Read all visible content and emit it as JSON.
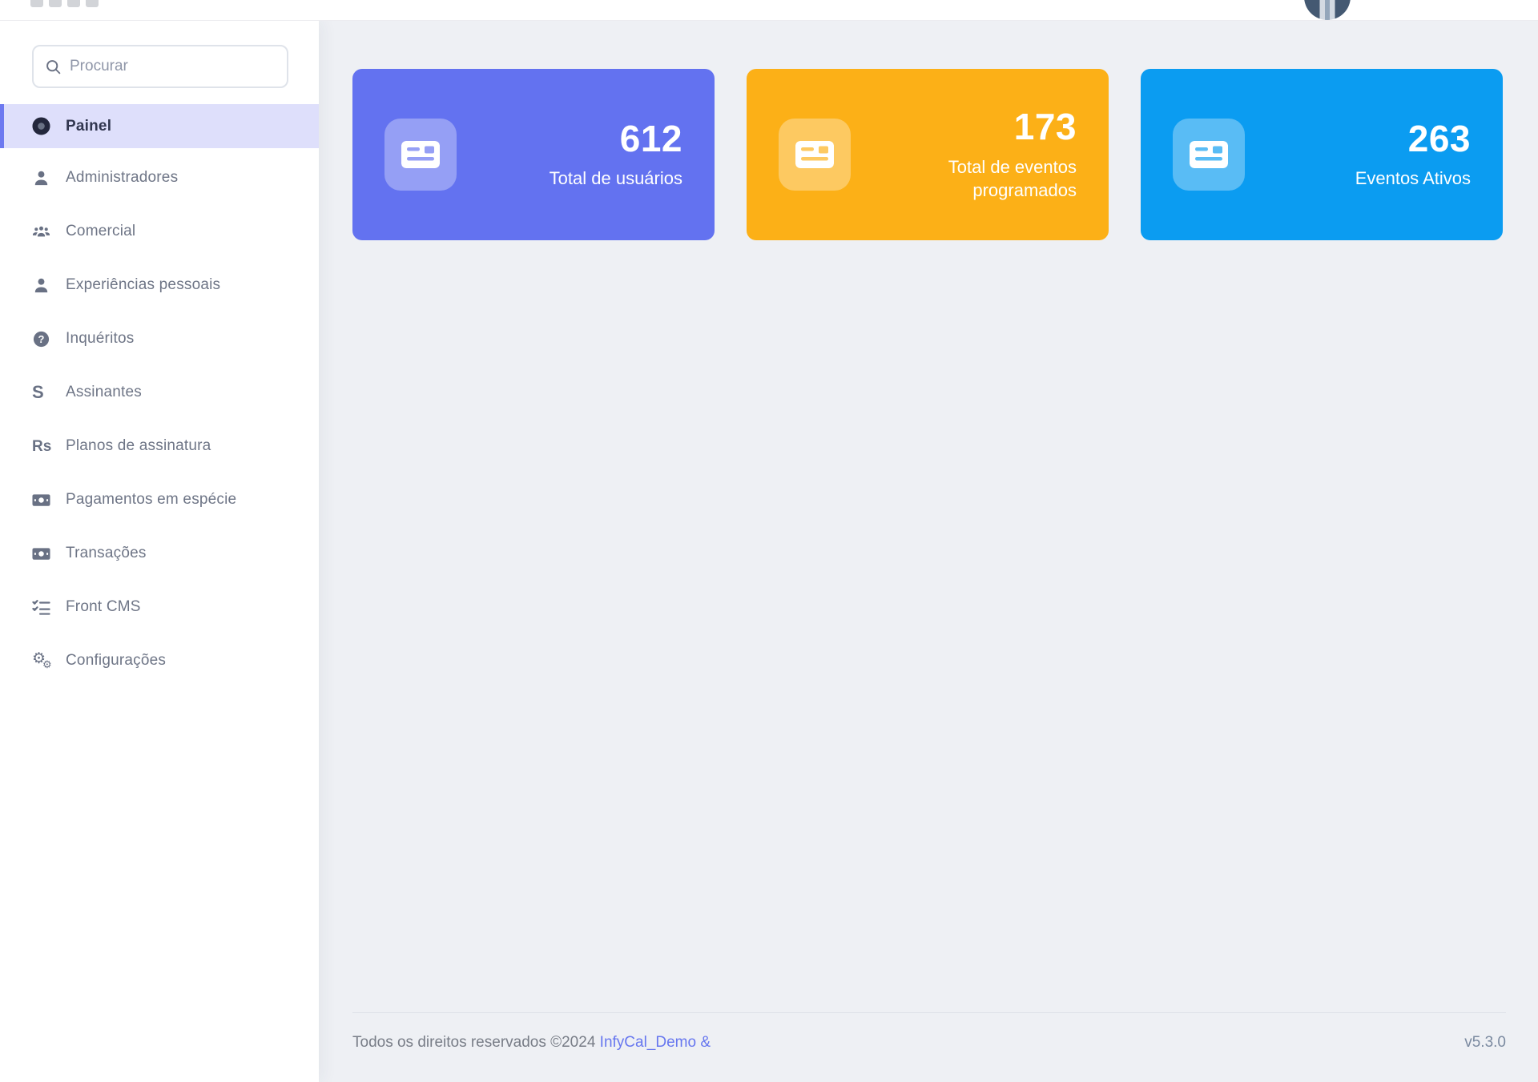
{
  "sidebar": {
    "search_placeholder": "Procurar",
    "items": [
      {
        "label": "Painel",
        "icon": "dashboard-donut-icon",
        "active": true
      },
      {
        "label": "Administradores",
        "icon": "person-icon",
        "active": false
      },
      {
        "label": "Comercial",
        "icon": "people-group-icon",
        "active": false
      },
      {
        "label": "Experiências pessoais",
        "icon": "person-icon",
        "active": false
      },
      {
        "label": "Inquéritos",
        "icon": "question-circle-icon",
        "active": false
      },
      {
        "label": "Assinantes",
        "icon": "stripe-s-icon",
        "active": false
      },
      {
        "label": "Planos de assinatura",
        "icon": "rupee-icon",
        "active": false
      },
      {
        "label": "Pagamentos em espécie",
        "icon": "cash-icon",
        "active": false
      },
      {
        "label": "Transações",
        "icon": "cash-icon",
        "active": false
      },
      {
        "label": "Front CMS",
        "icon": "checklist-icon",
        "active": false
      },
      {
        "label": "Configurações",
        "icon": "gears-icon",
        "active": false
      }
    ]
  },
  "stats": [
    {
      "value": "612",
      "label": "Total de usuários",
      "color": "#6372f0"
    },
    {
      "value": "173",
      "label": "Total de eventos programados",
      "color": "#fcb017"
    },
    {
      "value": "263",
      "label": "Eventos Ativos",
      "color": "#0b9cf1"
    }
  ],
  "footer": {
    "copyright": "Todos os direitos reservados ©2024",
    "link_label": "InfyCal_Demo &",
    "version": "v5.3.0"
  },
  "theme": {
    "primary": "#6372f0",
    "warning": "#fcb017",
    "info": "#0b9cf1",
    "link": "#6777ef",
    "sidebar_active_bg": "#dedffb"
  }
}
